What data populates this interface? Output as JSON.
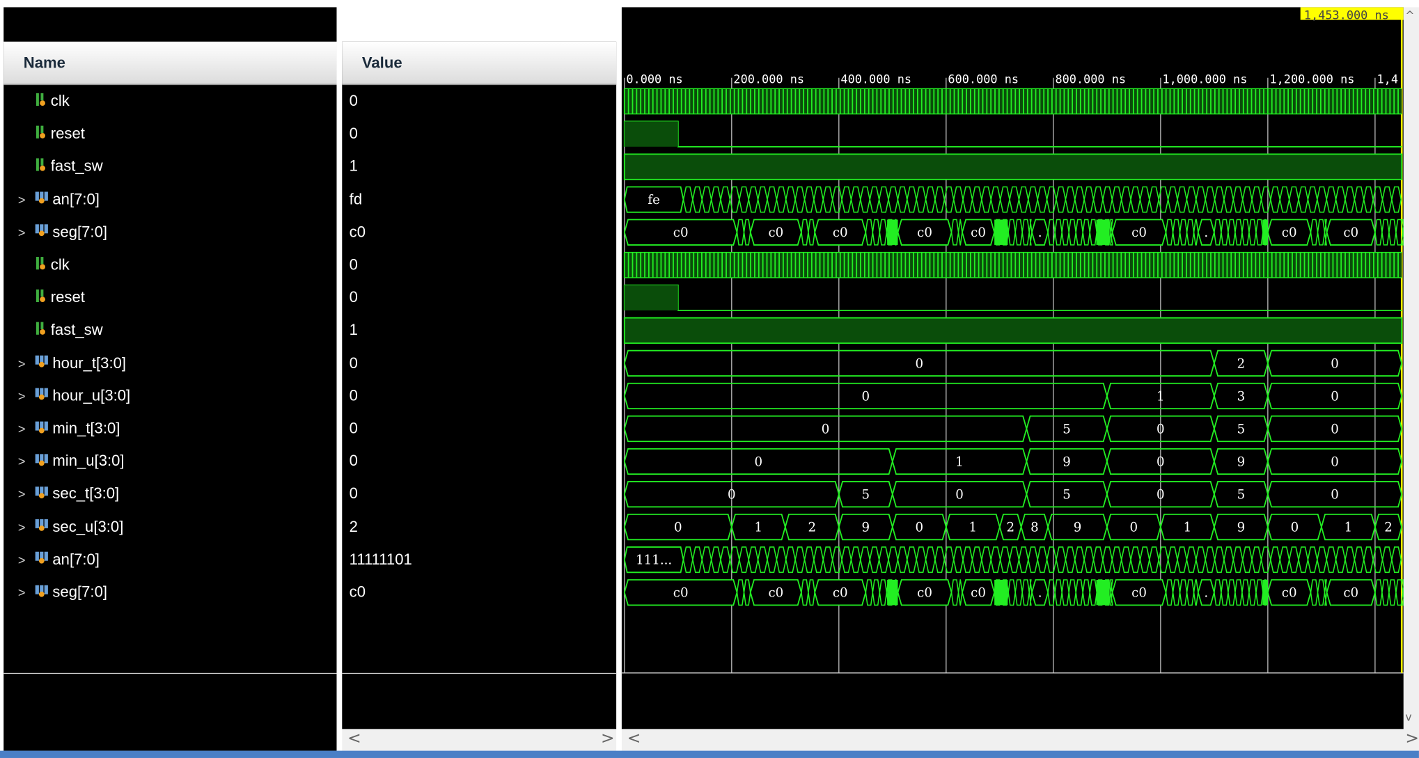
{
  "columns": {
    "name": "Name",
    "value": "Value"
  },
  "cursor_time": "1,453.000 ns",
  "timeline": {
    "ticks": [
      "0.000 ns",
      "200.000 ns",
      "400.000 ns",
      "600.000 ns",
      "800.000 ns",
      "1,000.000 ns",
      "1,200.000 ns",
      "1,4"
    ]
  },
  "signals": [
    {
      "name": "clk",
      "value": "0",
      "kind": "bit",
      "expandable": false
    },
    {
      "name": "reset",
      "value": "0",
      "kind": "bit",
      "expandable": false
    },
    {
      "name": "fast_sw",
      "value": "1",
      "kind": "bit",
      "expandable": false
    },
    {
      "name": "an[7:0]",
      "value": "fd",
      "kind": "bus",
      "expandable": true
    },
    {
      "name": "seg[7:0]",
      "value": "c0",
      "kind": "bus",
      "expandable": true
    },
    {
      "name": "clk",
      "value": "0",
      "kind": "bit",
      "expandable": false
    },
    {
      "name": "reset",
      "value": "0",
      "kind": "bit",
      "expandable": false
    },
    {
      "name": "fast_sw",
      "value": "1",
      "kind": "bit",
      "expandable": false
    },
    {
      "name": "hour_t[3:0]",
      "value": "0",
      "kind": "bus",
      "expandable": true
    },
    {
      "name": "hour_u[3:0]",
      "value": "0",
      "kind": "bus",
      "expandable": true
    },
    {
      "name": "min_t[3:0]",
      "value": "0",
      "kind": "bus",
      "expandable": true
    },
    {
      "name": "min_u[3:0]",
      "value": "0",
      "kind": "bus",
      "expandable": true
    },
    {
      "name": "sec_t[3:0]",
      "value": "0",
      "kind": "bus",
      "expandable": true
    },
    {
      "name": "sec_u[3:0]",
      "value": "2",
      "kind": "bus",
      "expandable": true
    },
    {
      "name": "an[7:0]",
      "value": "11111101",
      "kind": "bus",
      "expandable": true
    },
    {
      "name": "seg[7:0]",
      "value": "c0",
      "kind": "bus",
      "expandable": true
    }
  ],
  "waveforms": {
    "an_label": "fe",
    "an_bin_label": "111...",
    "seg_labels": [
      "c0",
      "c0",
      "c0",
      "c0",
      "c0",
      ".",
      "c0",
      ".",
      "c0",
      "c0"
    ],
    "hour_t": [
      {
        "t": 0,
        "v": "0"
      },
      {
        "t": 1100,
        "v": "2"
      },
      {
        "t": 1200,
        "v": "0"
      }
    ],
    "hour_u": [
      {
        "t": 0,
        "v": "0"
      },
      {
        "t": 900,
        "v": "1"
      },
      {
        "t": 1100,
        "v": "3"
      },
      {
        "t": 1200,
        "v": "0"
      }
    ],
    "min_t": [
      {
        "t": 0,
        "v": "0"
      },
      {
        "t": 750,
        "v": "5"
      },
      {
        "t": 900,
        "v": "0"
      },
      {
        "t": 1100,
        "v": "5"
      },
      {
        "t": 1200,
        "v": "0"
      }
    ],
    "min_u": [
      {
        "t": 0,
        "v": "0"
      },
      {
        "t": 500,
        "v": "1"
      },
      {
        "t": 750,
        "v": "9"
      },
      {
        "t": 900,
        "v": "0"
      },
      {
        "t": 1100,
        "v": "9"
      },
      {
        "t": 1200,
        "v": "0"
      }
    ],
    "sec_t": [
      {
        "t": 0,
        "v": "0"
      },
      {
        "t": 400,
        "v": "5"
      },
      {
        "t": 500,
        "v": "0"
      },
      {
        "t": 750,
        "v": "5"
      },
      {
        "t": 900,
        "v": "0"
      },
      {
        "t": 1100,
        "v": "5"
      },
      {
        "t": 1200,
        "v": "0"
      }
    ],
    "sec_u": [
      {
        "t": 0,
        "v": "0"
      },
      {
        "t": 200,
        "v": "1"
      },
      {
        "t": 300,
        "v": "2"
      },
      {
        "t": 400,
        "v": "9"
      },
      {
        "t": 500,
        "v": "0"
      },
      {
        "t": 600,
        "v": "1"
      },
      {
        "t": 700,
        "v": "2"
      },
      {
        "t": 740,
        "v": "8"
      },
      {
        "t": 790,
        "v": "9"
      },
      {
        "t": 900,
        "v": "0"
      },
      {
        "t": 1000,
        "v": "1"
      },
      {
        "t": 1100,
        "v": "9"
      },
      {
        "t": 1200,
        "v": "0"
      },
      {
        "t": 1300,
        "v": "1"
      },
      {
        "t": 1400,
        "v": "2"
      }
    ]
  },
  "colors": {
    "wave": "#22ee22",
    "fill": "#0a4d0a",
    "cursor": "#ffff00",
    "grid": "#bdbdbd"
  }
}
